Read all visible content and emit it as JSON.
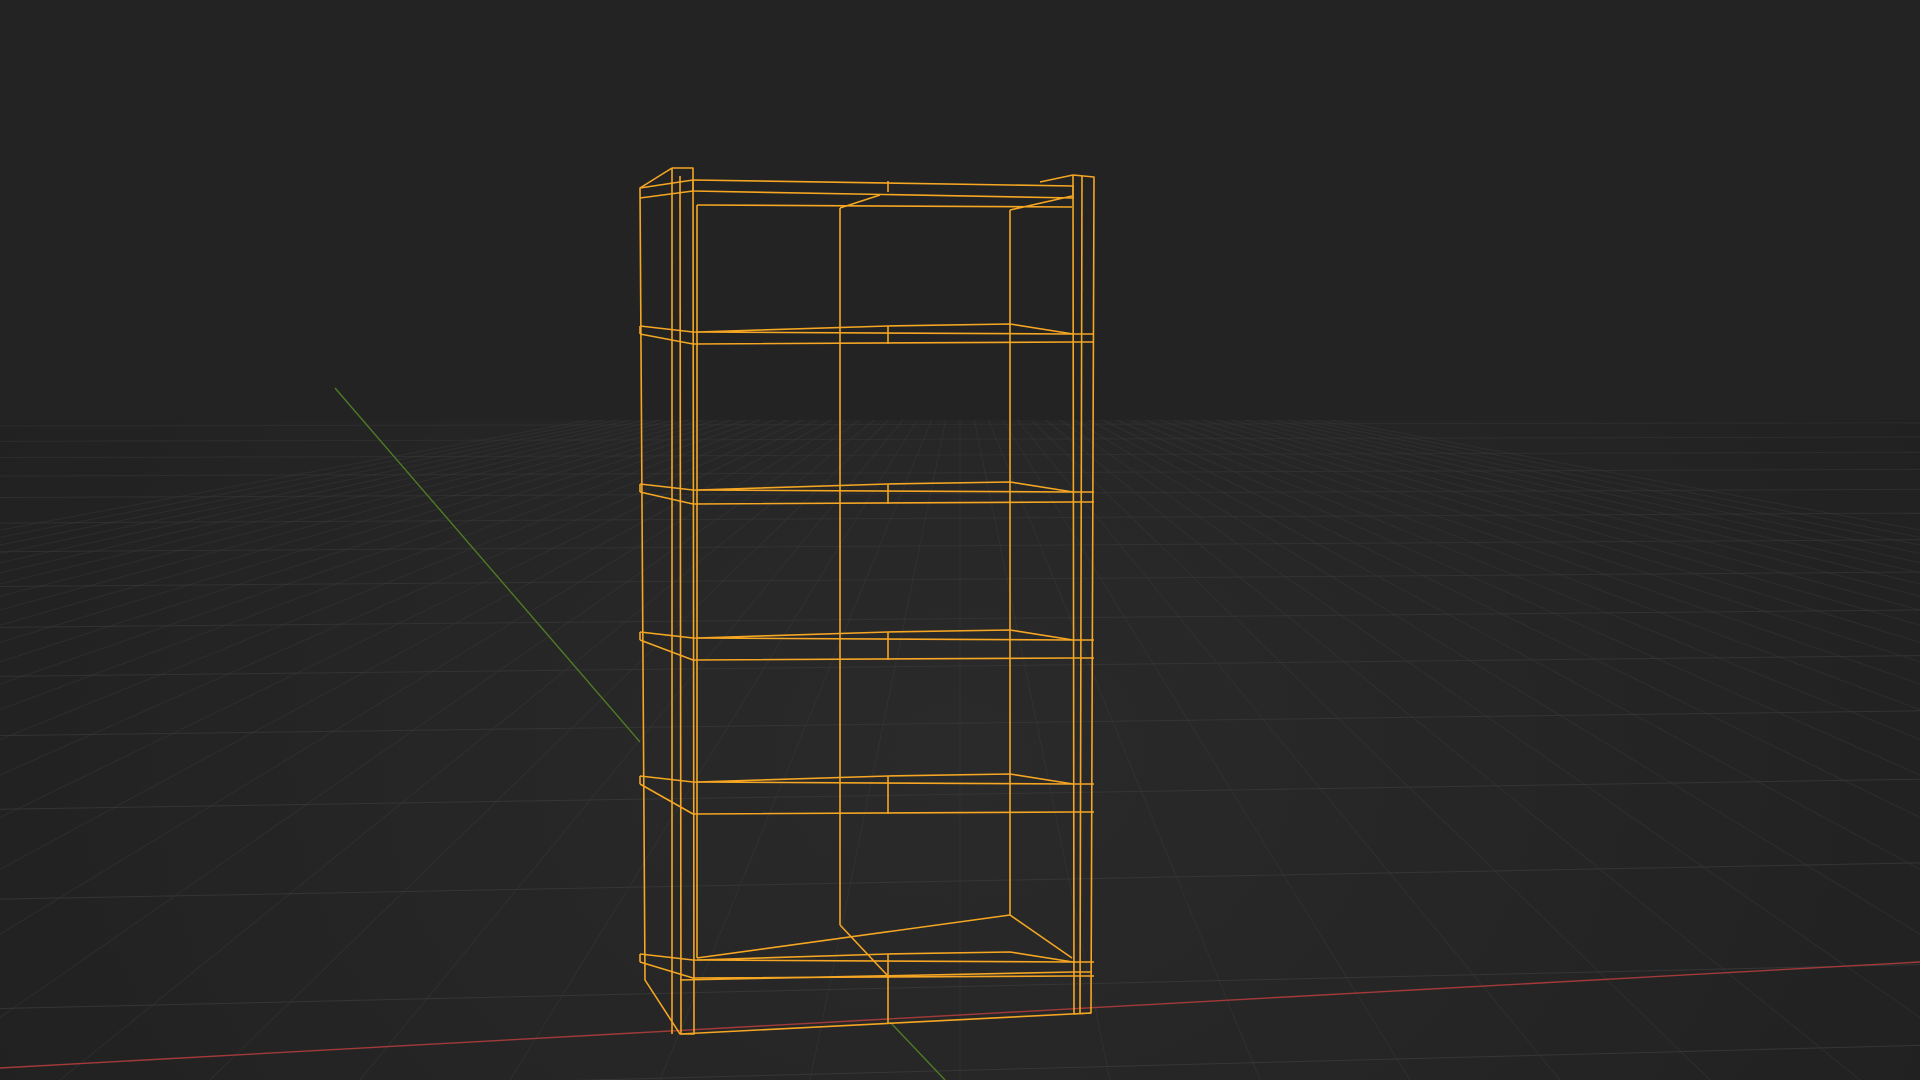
{
  "viewport": {
    "background": "#232323",
    "grid_color": "#3a3a3a",
    "x_axis_color": "#a33a3a",
    "y_axis_color": "#5f8a2a",
    "wire_color": "#f5a623"
  },
  "scene": {
    "selected_object": "bookshelf",
    "display_mode": "wireframe"
  }
}
